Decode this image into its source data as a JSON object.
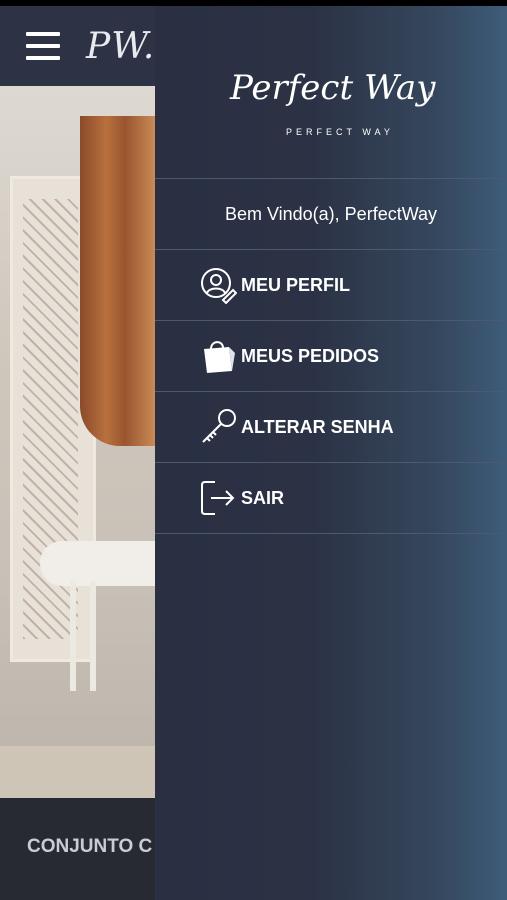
{
  "app_bar": {
    "brand": "PW."
  },
  "background": {
    "product_title": "CONJUNTO C"
  },
  "drawer": {
    "logo_script": "Perfect Way",
    "logo_mark": "®",
    "logo_subtitle": "PERFECT WAY",
    "welcome": "Bem Vindo(a), PerfectWay",
    "items": [
      {
        "label": "MEU PERFIL",
        "icon": "profile-edit-icon"
      },
      {
        "label": "MEUS PEDIDOS",
        "icon": "shopping-bag-icon"
      },
      {
        "label": "ALTERAR SENHA",
        "icon": "key-icon"
      },
      {
        "label": "SAIR",
        "icon": "logout-icon"
      }
    ]
  }
}
